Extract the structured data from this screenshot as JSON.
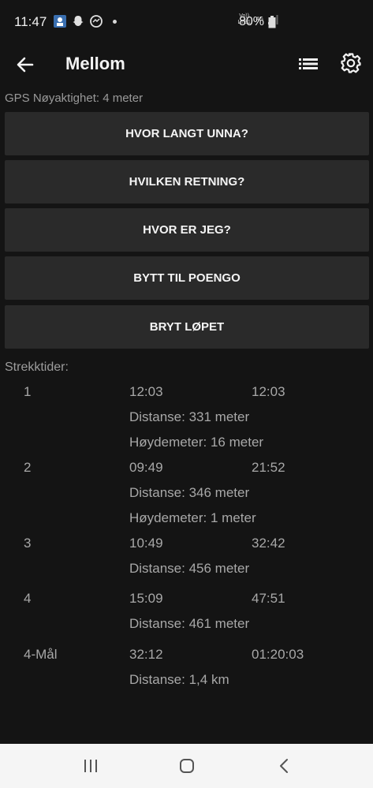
{
  "status": {
    "time": "11:47",
    "network_top": "Vo)) LTE1",
    "network_4g": "4G",
    "battery": "80%"
  },
  "appbar": {
    "title": "Mellom"
  },
  "gps": {
    "text": "GPS Nøyaktighet: 4 meter"
  },
  "buttons": [
    {
      "label": "HVOR LANGT UNNA?"
    },
    {
      "label": "HVILKEN RETNING?"
    },
    {
      "label": "HVOR ER JEG?"
    },
    {
      "label": "BYTT TIL POENGO"
    },
    {
      "label": "BRYT LØPET"
    }
  ],
  "splits": {
    "header": "Strekktider:",
    "legs": [
      {
        "num": "1",
        "split": "12:03",
        "total": "12:03",
        "distance": "Distanse: 331 meter",
        "climb": "Høydemeter: 16 meter"
      },
      {
        "num": "2",
        "split": "09:49",
        "total": "21:52",
        "distance": "Distanse: 346 meter",
        "climb": "Høydemeter: 1 meter"
      },
      {
        "num": "3",
        "split": "10:49",
        "total": "32:42",
        "distance": "Distanse: 456 meter"
      },
      {
        "num": "4",
        "split": "15:09",
        "total": "47:51",
        "distance": "Distanse: 461 meter"
      },
      {
        "num": "4-Mål",
        "split": "32:12",
        "total": "01:20:03",
        "distance": "Distanse: 1,4 km"
      }
    ]
  }
}
